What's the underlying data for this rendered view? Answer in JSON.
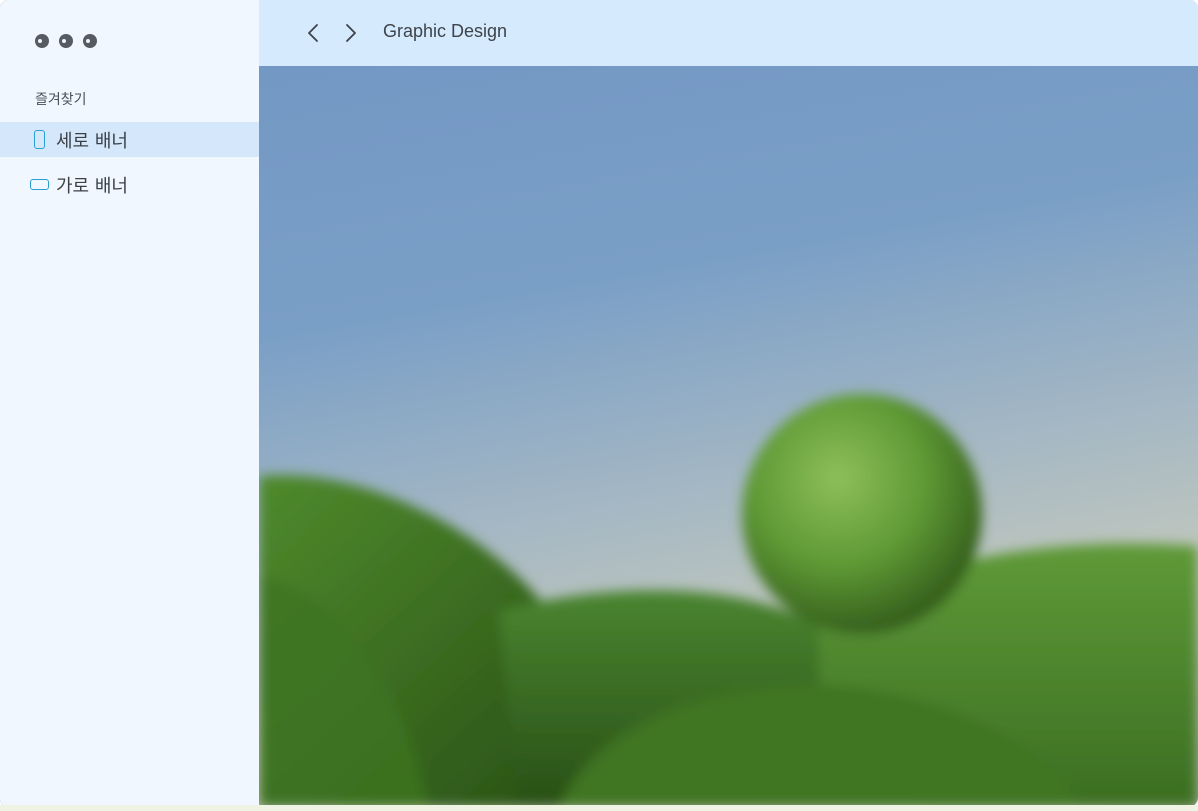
{
  "window": {
    "controls": [
      "close",
      "minimize",
      "maximize"
    ]
  },
  "sidebar": {
    "section_title": "즐겨찾기",
    "items": [
      {
        "label": "세로 배너",
        "icon": "vertical-rectangle-icon",
        "active": true
      },
      {
        "label": "가로 배너",
        "icon": "horizontal-rectangle-icon",
        "active": false
      }
    ]
  },
  "header": {
    "back_icon": "chevron-left-icon",
    "forward_icon": "chevron-right-icon",
    "title": "Graphic Design"
  },
  "content": {
    "image": "blurred green hills and sphere against blue sky"
  },
  "colors": {
    "sidebar_bg": "#f0f7ff",
    "header_bg": "#d6eafd",
    "active_item_bg": "#d5e8fb",
    "icon_accent": "#2a9fd6"
  }
}
